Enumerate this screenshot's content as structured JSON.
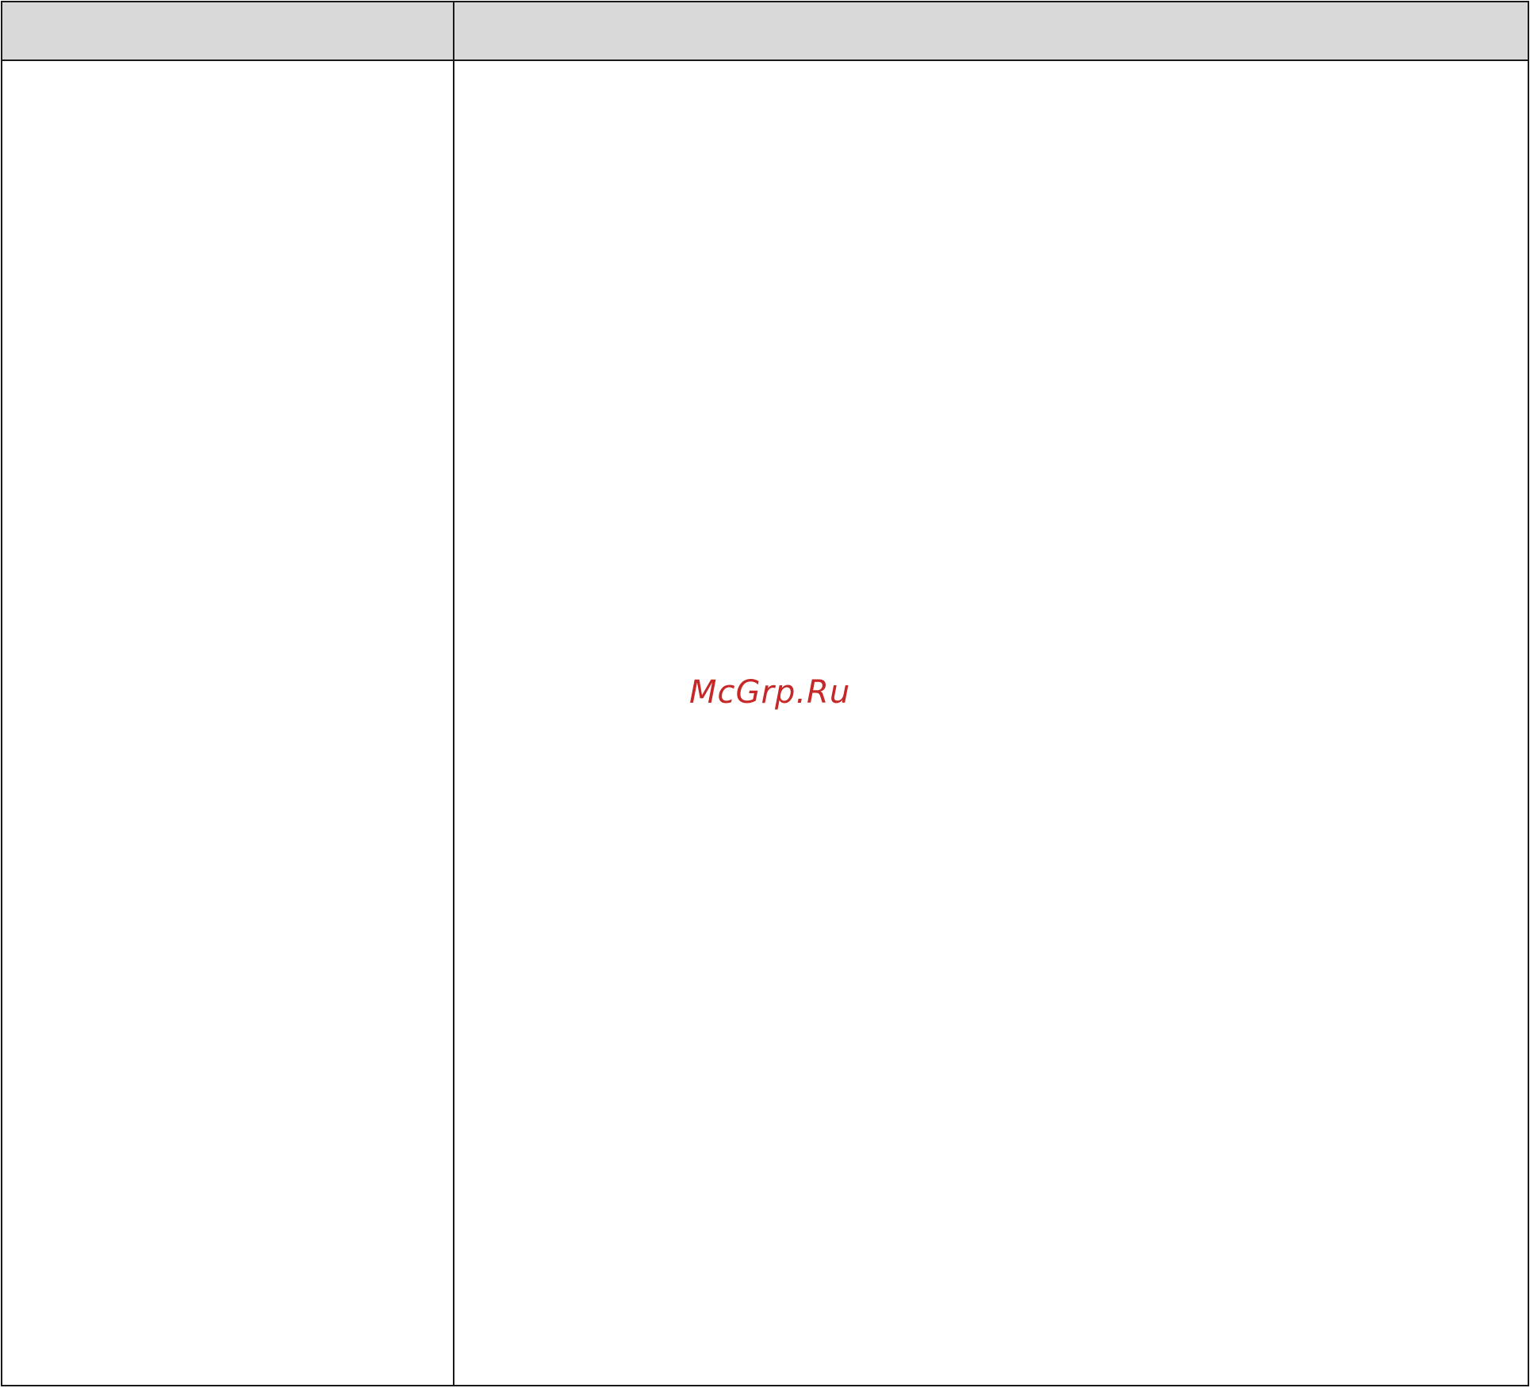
{
  "table": {
    "header": {
      "left": "",
      "right": ""
    },
    "body": {
      "left": "",
      "right": ""
    },
    "header_bg": "#d9d9d9",
    "border_color": "#1a1a1a"
  },
  "watermark": {
    "text": "McGrp.Ru",
    "color": "#c62828"
  }
}
